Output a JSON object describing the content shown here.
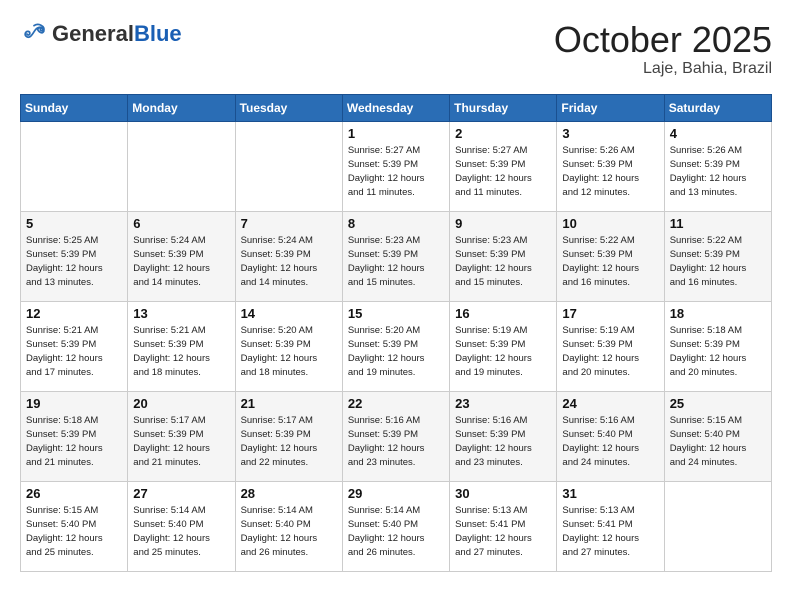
{
  "header": {
    "logo": {
      "general": "General",
      "blue": "Blue"
    },
    "title": "October 2025",
    "location": "Laje, Bahia, Brazil"
  },
  "weekdays": [
    "Sunday",
    "Monday",
    "Tuesday",
    "Wednesday",
    "Thursday",
    "Friday",
    "Saturday"
  ],
  "weeks": [
    [
      {
        "day": "",
        "info": ""
      },
      {
        "day": "",
        "info": ""
      },
      {
        "day": "",
        "info": ""
      },
      {
        "day": "1",
        "info": "Sunrise: 5:27 AM\nSunset: 5:39 PM\nDaylight: 12 hours\nand 11 minutes."
      },
      {
        "day": "2",
        "info": "Sunrise: 5:27 AM\nSunset: 5:39 PM\nDaylight: 12 hours\nand 11 minutes."
      },
      {
        "day": "3",
        "info": "Sunrise: 5:26 AM\nSunset: 5:39 PM\nDaylight: 12 hours\nand 12 minutes."
      },
      {
        "day": "4",
        "info": "Sunrise: 5:26 AM\nSunset: 5:39 PM\nDaylight: 12 hours\nand 13 minutes."
      }
    ],
    [
      {
        "day": "5",
        "info": "Sunrise: 5:25 AM\nSunset: 5:39 PM\nDaylight: 12 hours\nand 13 minutes."
      },
      {
        "day": "6",
        "info": "Sunrise: 5:24 AM\nSunset: 5:39 PM\nDaylight: 12 hours\nand 14 minutes."
      },
      {
        "day": "7",
        "info": "Sunrise: 5:24 AM\nSunset: 5:39 PM\nDaylight: 12 hours\nand 14 minutes."
      },
      {
        "day": "8",
        "info": "Sunrise: 5:23 AM\nSunset: 5:39 PM\nDaylight: 12 hours\nand 15 minutes."
      },
      {
        "day": "9",
        "info": "Sunrise: 5:23 AM\nSunset: 5:39 PM\nDaylight: 12 hours\nand 15 minutes."
      },
      {
        "day": "10",
        "info": "Sunrise: 5:22 AM\nSunset: 5:39 PM\nDaylight: 12 hours\nand 16 minutes."
      },
      {
        "day": "11",
        "info": "Sunrise: 5:22 AM\nSunset: 5:39 PM\nDaylight: 12 hours\nand 16 minutes."
      }
    ],
    [
      {
        "day": "12",
        "info": "Sunrise: 5:21 AM\nSunset: 5:39 PM\nDaylight: 12 hours\nand 17 minutes."
      },
      {
        "day": "13",
        "info": "Sunrise: 5:21 AM\nSunset: 5:39 PM\nDaylight: 12 hours\nand 18 minutes."
      },
      {
        "day": "14",
        "info": "Sunrise: 5:20 AM\nSunset: 5:39 PM\nDaylight: 12 hours\nand 18 minutes."
      },
      {
        "day": "15",
        "info": "Sunrise: 5:20 AM\nSunset: 5:39 PM\nDaylight: 12 hours\nand 19 minutes."
      },
      {
        "day": "16",
        "info": "Sunrise: 5:19 AM\nSunset: 5:39 PM\nDaylight: 12 hours\nand 19 minutes."
      },
      {
        "day": "17",
        "info": "Sunrise: 5:19 AM\nSunset: 5:39 PM\nDaylight: 12 hours\nand 20 minutes."
      },
      {
        "day": "18",
        "info": "Sunrise: 5:18 AM\nSunset: 5:39 PM\nDaylight: 12 hours\nand 20 minutes."
      }
    ],
    [
      {
        "day": "19",
        "info": "Sunrise: 5:18 AM\nSunset: 5:39 PM\nDaylight: 12 hours\nand 21 minutes."
      },
      {
        "day": "20",
        "info": "Sunrise: 5:17 AM\nSunset: 5:39 PM\nDaylight: 12 hours\nand 21 minutes."
      },
      {
        "day": "21",
        "info": "Sunrise: 5:17 AM\nSunset: 5:39 PM\nDaylight: 12 hours\nand 22 minutes."
      },
      {
        "day": "22",
        "info": "Sunrise: 5:16 AM\nSunset: 5:39 PM\nDaylight: 12 hours\nand 23 minutes."
      },
      {
        "day": "23",
        "info": "Sunrise: 5:16 AM\nSunset: 5:39 PM\nDaylight: 12 hours\nand 23 minutes."
      },
      {
        "day": "24",
        "info": "Sunrise: 5:16 AM\nSunset: 5:40 PM\nDaylight: 12 hours\nand 24 minutes."
      },
      {
        "day": "25",
        "info": "Sunrise: 5:15 AM\nSunset: 5:40 PM\nDaylight: 12 hours\nand 24 minutes."
      }
    ],
    [
      {
        "day": "26",
        "info": "Sunrise: 5:15 AM\nSunset: 5:40 PM\nDaylight: 12 hours\nand 25 minutes."
      },
      {
        "day": "27",
        "info": "Sunrise: 5:14 AM\nSunset: 5:40 PM\nDaylight: 12 hours\nand 25 minutes."
      },
      {
        "day": "28",
        "info": "Sunrise: 5:14 AM\nSunset: 5:40 PM\nDaylight: 12 hours\nand 26 minutes."
      },
      {
        "day": "29",
        "info": "Sunrise: 5:14 AM\nSunset: 5:40 PM\nDaylight: 12 hours\nand 26 minutes."
      },
      {
        "day": "30",
        "info": "Sunrise: 5:13 AM\nSunset: 5:41 PM\nDaylight: 12 hours\nand 27 minutes."
      },
      {
        "day": "31",
        "info": "Sunrise: 5:13 AM\nSunset: 5:41 PM\nDaylight: 12 hours\nand 27 minutes."
      },
      {
        "day": "",
        "info": ""
      }
    ]
  ]
}
